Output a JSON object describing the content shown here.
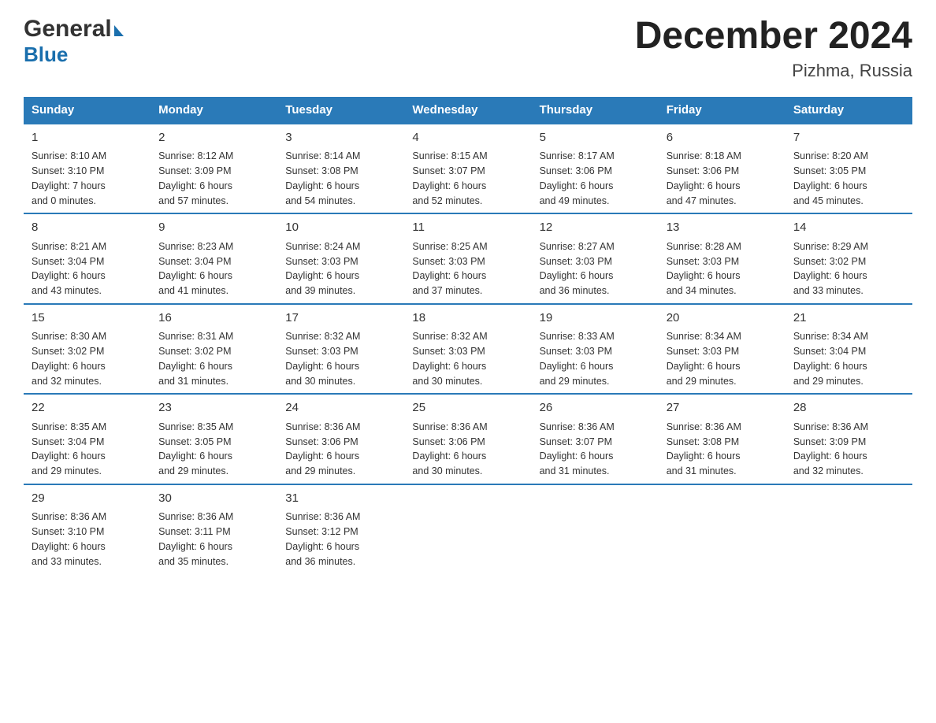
{
  "logo": {
    "general": "General",
    "blue": "Blue",
    "arrow": "▶"
  },
  "title": "December 2024",
  "subtitle": "Pizhma, Russia",
  "days_of_week": [
    "Sunday",
    "Monday",
    "Tuesday",
    "Wednesday",
    "Thursday",
    "Friday",
    "Saturday"
  ],
  "weeks": [
    [
      {
        "day": "1",
        "sunrise": "8:10 AM",
        "sunset": "3:10 PM",
        "daylight": "7 hours and 0 minutes."
      },
      {
        "day": "2",
        "sunrise": "8:12 AM",
        "sunset": "3:09 PM",
        "daylight": "6 hours and 57 minutes."
      },
      {
        "day": "3",
        "sunrise": "8:14 AM",
        "sunset": "3:08 PM",
        "daylight": "6 hours and 54 minutes."
      },
      {
        "day": "4",
        "sunrise": "8:15 AM",
        "sunset": "3:07 PM",
        "daylight": "6 hours and 52 minutes."
      },
      {
        "day": "5",
        "sunrise": "8:17 AM",
        "sunset": "3:06 PM",
        "daylight": "6 hours and 49 minutes."
      },
      {
        "day": "6",
        "sunrise": "8:18 AM",
        "sunset": "3:06 PM",
        "daylight": "6 hours and 47 minutes."
      },
      {
        "day": "7",
        "sunrise": "8:20 AM",
        "sunset": "3:05 PM",
        "daylight": "6 hours and 45 minutes."
      }
    ],
    [
      {
        "day": "8",
        "sunrise": "8:21 AM",
        "sunset": "3:04 PM",
        "daylight": "6 hours and 43 minutes."
      },
      {
        "day": "9",
        "sunrise": "8:23 AM",
        "sunset": "3:04 PM",
        "daylight": "6 hours and 41 minutes."
      },
      {
        "day": "10",
        "sunrise": "8:24 AM",
        "sunset": "3:03 PM",
        "daylight": "6 hours and 39 minutes."
      },
      {
        "day": "11",
        "sunrise": "8:25 AM",
        "sunset": "3:03 PM",
        "daylight": "6 hours and 37 minutes."
      },
      {
        "day": "12",
        "sunrise": "8:27 AM",
        "sunset": "3:03 PM",
        "daylight": "6 hours and 36 minutes."
      },
      {
        "day": "13",
        "sunrise": "8:28 AM",
        "sunset": "3:03 PM",
        "daylight": "6 hours and 34 minutes."
      },
      {
        "day": "14",
        "sunrise": "8:29 AM",
        "sunset": "3:02 PM",
        "daylight": "6 hours and 33 minutes."
      }
    ],
    [
      {
        "day": "15",
        "sunrise": "8:30 AM",
        "sunset": "3:02 PM",
        "daylight": "6 hours and 32 minutes."
      },
      {
        "day": "16",
        "sunrise": "8:31 AM",
        "sunset": "3:02 PM",
        "daylight": "6 hours and 31 minutes."
      },
      {
        "day": "17",
        "sunrise": "8:32 AM",
        "sunset": "3:03 PM",
        "daylight": "6 hours and 30 minutes."
      },
      {
        "day": "18",
        "sunrise": "8:32 AM",
        "sunset": "3:03 PM",
        "daylight": "6 hours and 30 minutes."
      },
      {
        "day": "19",
        "sunrise": "8:33 AM",
        "sunset": "3:03 PM",
        "daylight": "6 hours and 29 minutes."
      },
      {
        "day": "20",
        "sunrise": "8:34 AM",
        "sunset": "3:03 PM",
        "daylight": "6 hours and 29 minutes."
      },
      {
        "day": "21",
        "sunrise": "8:34 AM",
        "sunset": "3:04 PM",
        "daylight": "6 hours and 29 minutes."
      }
    ],
    [
      {
        "day": "22",
        "sunrise": "8:35 AM",
        "sunset": "3:04 PM",
        "daylight": "6 hours and 29 minutes."
      },
      {
        "day": "23",
        "sunrise": "8:35 AM",
        "sunset": "3:05 PM",
        "daylight": "6 hours and 29 minutes."
      },
      {
        "day": "24",
        "sunrise": "8:36 AM",
        "sunset": "3:06 PM",
        "daylight": "6 hours and 29 minutes."
      },
      {
        "day": "25",
        "sunrise": "8:36 AM",
        "sunset": "3:06 PM",
        "daylight": "6 hours and 30 minutes."
      },
      {
        "day": "26",
        "sunrise": "8:36 AM",
        "sunset": "3:07 PM",
        "daylight": "6 hours and 31 minutes."
      },
      {
        "day": "27",
        "sunrise": "8:36 AM",
        "sunset": "3:08 PM",
        "daylight": "6 hours and 31 minutes."
      },
      {
        "day": "28",
        "sunrise": "8:36 AM",
        "sunset": "3:09 PM",
        "daylight": "6 hours and 32 minutes."
      }
    ],
    [
      {
        "day": "29",
        "sunrise": "8:36 AM",
        "sunset": "3:10 PM",
        "daylight": "6 hours and 33 minutes."
      },
      {
        "day": "30",
        "sunrise": "8:36 AM",
        "sunset": "3:11 PM",
        "daylight": "6 hours and 35 minutes."
      },
      {
        "day": "31",
        "sunrise": "8:36 AM",
        "sunset": "3:12 PM",
        "daylight": "6 hours and 36 minutes."
      },
      null,
      null,
      null,
      null
    ]
  ],
  "labels": {
    "sunrise": "Sunrise:",
    "sunset": "Sunset:",
    "daylight": "Daylight:"
  }
}
